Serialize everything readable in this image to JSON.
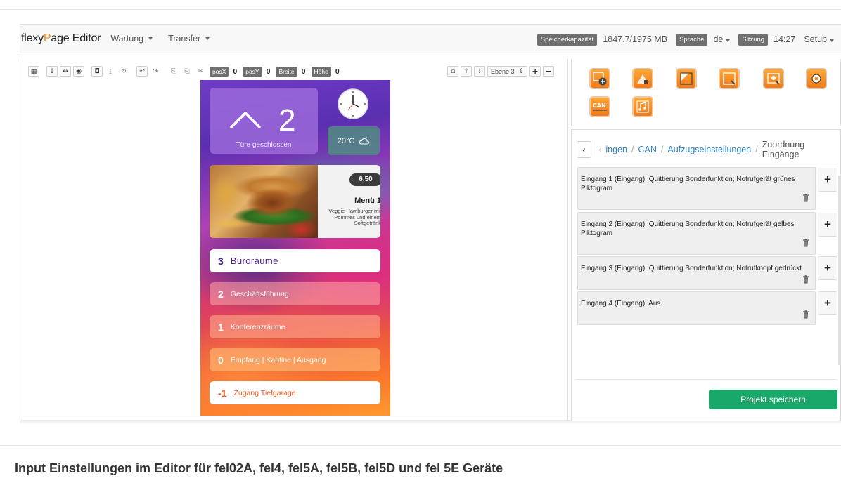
{
  "navbar": {
    "brand_prefix": "flexy",
    "brand_accent": "P",
    "brand_suffix": "age Editor",
    "menus": [
      "Wartung",
      "Transfer"
    ],
    "storage_label": "Speicherkapazität",
    "storage_value": "1847.7/1975 MB",
    "language_label": "Sprache",
    "language_value": "de",
    "session_label": "Sitzung",
    "session_value": "14:27",
    "setup_label": "Setup"
  },
  "toolbar": {
    "posx_label": "posX",
    "posx_value": "0",
    "posy_label": "posY",
    "posy_value": "0",
    "width_label": "Breite",
    "width_value": "0",
    "height_label": "Höhe",
    "height_value": "0",
    "layer_value": "Ebene 3"
  },
  "preview": {
    "door_number": "2",
    "door_status": "Türe geschlossen",
    "temperature": "20°C",
    "menu_price": "6,50",
    "menu_title": "Menü 1",
    "menu_description": "Veggie Hamburger mit Pommes und einem Softgetränk",
    "floors": [
      {
        "number": "3",
        "label": "Büroräume"
      },
      {
        "number": "2",
        "label": "Geschäftsführung"
      },
      {
        "number": "1",
        "label": "Konferenzräume"
      },
      {
        "number": "0",
        "label": "Empfang | Kantine | Ausgang"
      },
      {
        "number": "-1",
        "label": "Zugang Tiefgarage"
      }
    ]
  },
  "tile_icons": [
    "tile-add-icon",
    "tile-home-icon",
    "tile-corner-icon",
    "tile-link-icon",
    "tile-settings-icon",
    "tile-gear-icon",
    "tile-can-icon",
    "tile-music-icon"
  ],
  "breadcrumb": {
    "faded": "ingen",
    "items": [
      "CAN",
      "Aufzugseinstellungen"
    ],
    "current": "Zuordnung Eingänge"
  },
  "entries": [
    "Eingang 1 (Eingang); Quittierung Sonderfunktion; Notrufgerät grünes Piktogram",
    "Eingang 2 (Eingang); Quittierung Sonderfunktion; Notrufgerät gelbes Piktogram",
    "Eingang 3 (Eingang); Quittierung Sonderfunktion; Notrufknopf gedrückt",
    "Eingang 4 (Eingang); Aus"
  ],
  "save_label": "Projekt speichern",
  "caption": "Input Einstellungen im Editor für fel02A, fel4, fel5A, fel5B, fel5D und fel 5E Geräte",
  "colors": {
    "brand_accent": "#ef8a14",
    "save_button": "#1aa86a",
    "link": "#2a7fc2",
    "active_floor_text": "#4a1e8a",
    "garage_floor_text": "#f05a1e"
  }
}
